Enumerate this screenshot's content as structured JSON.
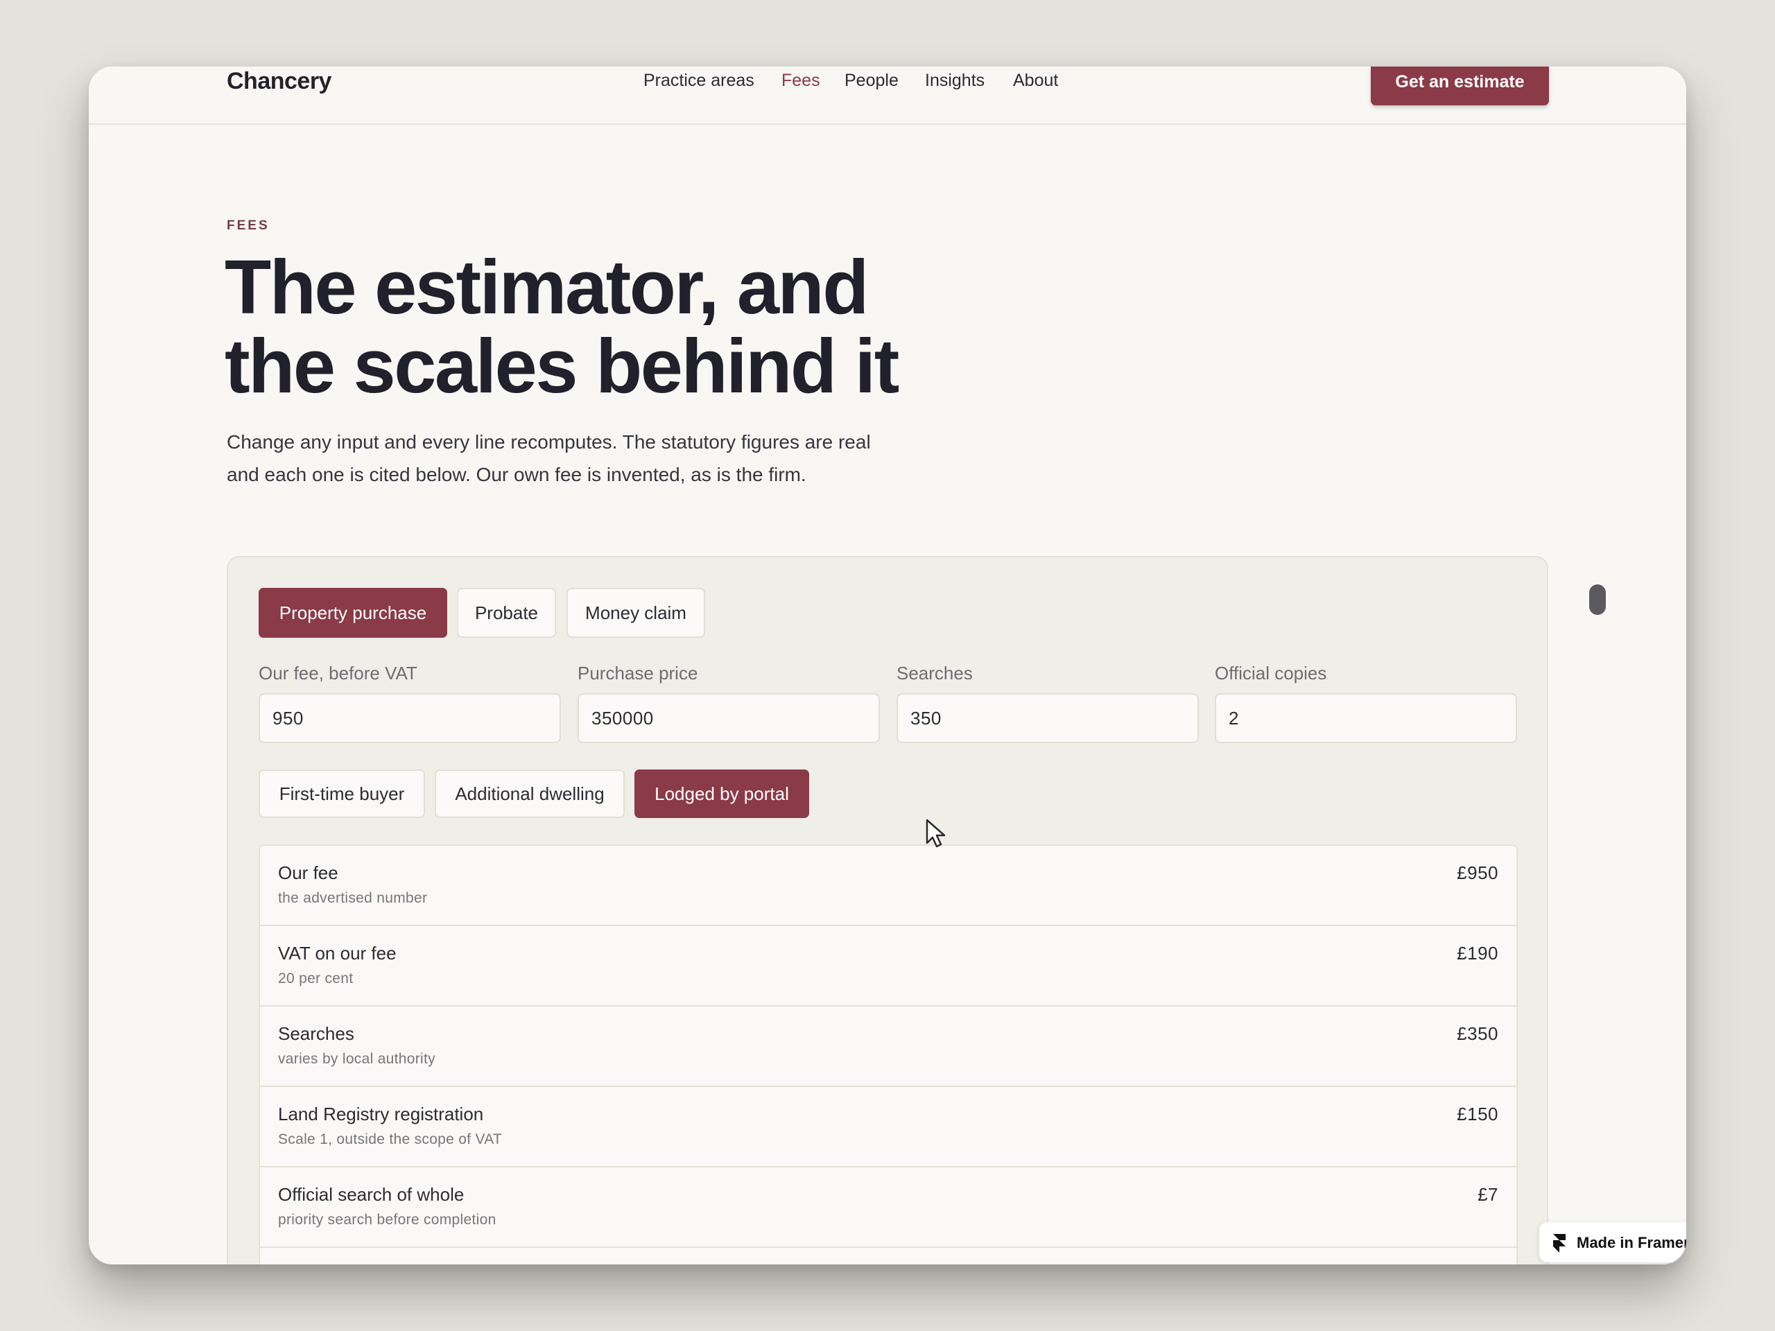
{
  "header": {
    "brand": "Chancery",
    "nav": [
      {
        "label": "Practice areas",
        "active": false
      },
      {
        "label": "Fees",
        "active": true
      },
      {
        "label": "People",
        "active": false
      },
      {
        "label": "Insights",
        "active": false
      },
      {
        "label": "About",
        "active": false
      }
    ],
    "cta_label": "Get an estimate"
  },
  "hero": {
    "eyebrow": "FEES",
    "title_line1": "The estimator, and",
    "title_line2": "the scales behind it",
    "intro": "Change any input and every line recomputes. The statutory figures are real and each one is cited below. Our own fee is invented, as is the firm."
  },
  "estimator": {
    "tabs": [
      {
        "label": "Property purchase",
        "active": true
      },
      {
        "label": "Probate",
        "active": false
      },
      {
        "label": "Money claim",
        "active": false
      }
    ],
    "fields": [
      {
        "label": "Our fee, before VAT",
        "value": "950"
      },
      {
        "label": "Purchase price",
        "value": "350000"
      },
      {
        "label": "Searches",
        "value": "350"
      },
      {
        "label": "Official copies",
        "value": "2"
      }
    ],
    "toggles": [
      {
        "label": "First-time buyer",
        "active": false
      },
      {
        "label": "Additional dwelling",
        "active": false
      },
      {
        "label": "Lodged by portal",
        "active": true
      }
    ],
    "lines": [
      {
        "label": "Our fee",
        "note": "the advertised number",
        "amount": "£950"
      },
      {
        "label": "VAT on our fee",
        "note": "20 per cent",
        "amount": "£190"
      },
      {
        "label": "Searches",
        "note": "varies by local authority",
        "amount": "£350"
      },
      {
        "label": "Land Registry registration",
        "note": "Scale 1, outside the scope of VAT",
        "amount": "£150"
      },
      {
        "label": "Official search of whole",
        "note": "priority search before completion",
        "amount": "£7"
      }
    ]
  },
  "badge": {
    "label": "Made in Framer"
  },
  "colors": {
    "accent": "#8b3a47",
    "background": "#f8f7f4",
    "panel": "#f0eee8"
  }
}
